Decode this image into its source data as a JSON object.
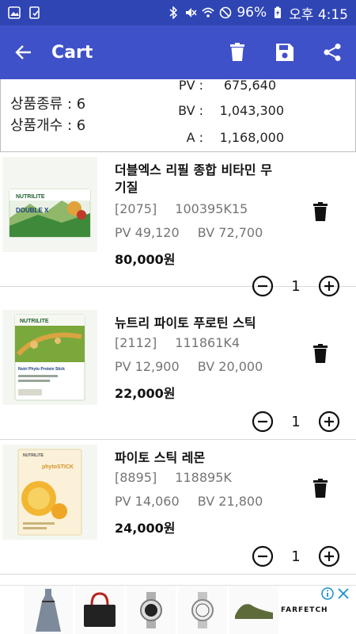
{
  "status_bar": {
    "battery": "96%",
    "time": "오후 4:15"
  },
  "app_bar": {
    "title": "Cart"
  },
  "summary": {
    "kinds_label": "상품종류 : 6",
    "count_label": "상품개수 : 6",
    "pv_label": "PV :",
    "pv_value": "675,640",
    "bv_label": "BV :",
    "bv_value": "1,043,300",
    "a_label": "A :",
    "a_value": "1,168,000"
  },
  "items": [
    {
      "name": "더블엑스 리필 종합 비타민 무기질",
      "code_num": "[2075]",
      "code_id": "100395K15",
      "pv": "PV 49,120",
      "bv": "BV 72,700",
      "price": "80,000원",
      "qty": "1",
      "brand": "NUTRILITE",
      "product_label": "DOUBLE X"
    },
    {
      "name": "뉴트리 파이토 푸로틴 스틱",
      "code_num": "[2112]",
      "code_id": "111861K4",
      "pv": "PV 12,900",
      "bv": "BV 20,000",
      "price": "22,000원",
      "qty": "1",
      "brand": "NUTRILITE",
      "product_label": "Nutri Phyto Protein Stick"
    },
    {
      "name": "파이토 스틱 레몬",
      "code_num": "[8895]",
      "code_id": "118895K",
      "pv": "PV 14,060",
      "bv": "BV 21,800",
      "price": "24,000원",
      "qty": "1",
      "brand": "NUTRILITE",
      "product_label": "phytoSTICK"
    }
  ],
  "ad": {
    "brand": "FARFETCH"
  },
  "colors": {
    "status_bar": "#2f45b4",
    "app_bar": "#3f51c8"
  }
}
